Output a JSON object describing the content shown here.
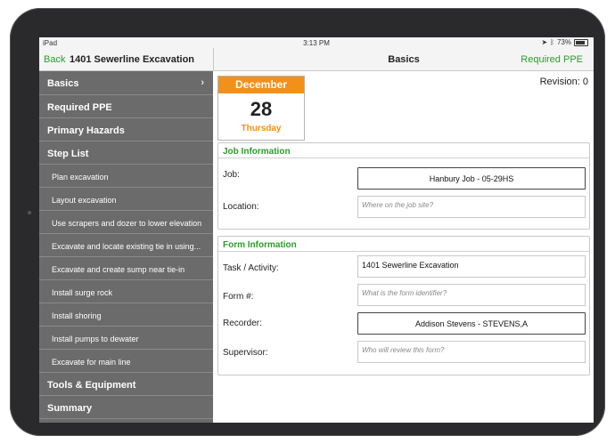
{
  "status_bar": {
    "device": "iPad",
    "time": "3:13 PM",
    "battery": "73%"
  },
  "left_nav": {
    "back_label": "Back",
    "title": "1401 Sewerline Excavation"
  },
  "right_nav": {
    "title": "Basics",
    "right_link": "Required PPE"
  },
  "sidebar": {
    "items": [
      {
        "label": "Basics",
        "type": "section",
        "chevron": true
      },
      {
        "label": "Required PPE",
        "type": "section"
      },
      {
        "label": "Primary Hazards",
        "type": "section"
      },
      {
        "label": "Step List",
        "type": "section"
      },
      {
        "label": "Plan excavation",
        "type": "sub"
      },
      {
        "label": "Layout excavation",
        "type": "sub"
      },
      {
        "label": "Use scrapers and dozer to lower elevation",
        "type": "sub"
      },
      {
        "label": "Excavate and locate existing tie in using...",
        "type": "sub"
      },
      {
        "label": "Excavate and create sump near tie-in",
        "type": "sub"
      },
      {
        "label": "Install surge rock",
        "type": "sub"
      },
      {
        "label": "Install shoring",
        "type": "sub"
      },
      {
        "label": "Install pumps to dewater",
        "type": "sub"
      },
      {
        "label": "Excavate for main line",
        "type": "sub"
      },
      {
        "label": "Tools & Equipment",
        "type": "section"
      },
      {
        "label": "Summary",
        "type": "section"
      }
    ]
  },
  "revision": "Revision: 0",
  "calendar": {
    "month": "December",
    "day": "28",
    "weekday": "Thursday",
    "accent_color": "#f39019"
  },
  "job_info": {
    "heading": "Job Information",
    "job_label": "Job:",
    "job_value": "Hanbury Job - 05-29HS",
    "location_label": "Location:",
    "location_placeholder": "Where on the job site?"
  },
  "form_info": {
    "heading": "Form Information",
    "task_label": "Task / Activity:",
    "task_value": "1401 Sewerline Excavation",
    "form_label": "Form #:",
    "form_placeholder": "What is the form identifier?",
    "recorder_label": "Recorder:",
    "recorder_value": "Addison Stevens - STEVENS,A",
    "supervisor_label": "Supervisor:",
    "supervisor_placeholder": "Who will review this form?"
  },
  "colors": {
    "accent_green": "#2e9b2e",
    "sidebar_bg": "#6b6b6b",
    "calendar_orange": "#f39019"
  }
}
